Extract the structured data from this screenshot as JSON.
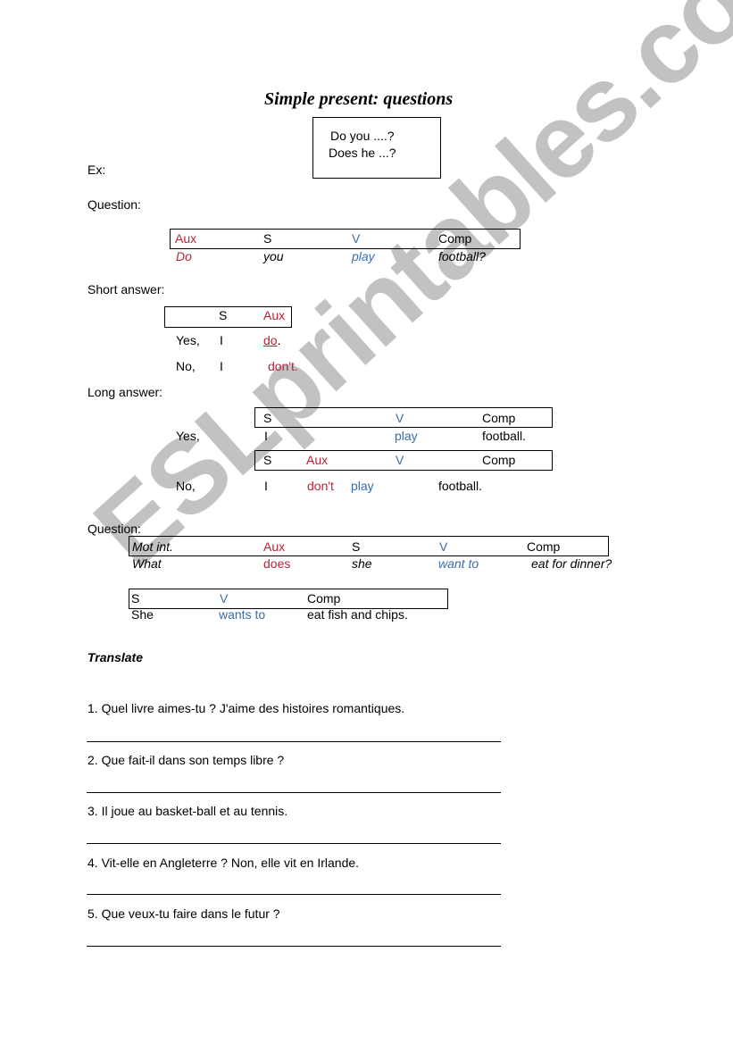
{
  "title": "Simple present: questions",
  "example_box": {
    "line1": "Do you ....?",
    "line2": "Does he ...?"
  },
  "ex_label": "Ex:",
  "question1": {
    "label": "Question:",
    "headers": [
      "Aux",
      "S",
      "V",
      "Comp"
    ],
    "words": [
      "Do",
      "you",
      "play",
      "football?"
    ]
  },
  "short_answer": {
    "label": "Short answer:",
    "headers": [
      "S",
      "Aux"
    ],
    "rows": [
      {
        "lead": "Yes,",
        "s": "I",
        "aux": "do",
        "end": "."
      },
      {
        "lead": "No,",
        "s": "I",
        "aux": "don't.",
        "end": ""
      }
    ]
  },
  "long_answer": {
    "label": "Long answer:",
    "yes": {
      "lead": "Yes,",
      "headers": [
        "S",
        "V",
        "Comp"
      ],
      "words": [
        "I",
        "play",
        "football."
      ]
    },
    "no": {
      "lead": "No,",
      "headers": [
        "S",
        "Aux",
        "V",
        "Comp"
      ],
      "words": [
        "I",
        "don't",
        "play",
        "football."
      ]
    }
  },
  "question2": {
    "label": "Question:",
    "headers": [
      "Mot int.",
      "Aux",
      "S",
      "V",
      "Comp"
    ],
    "words": [
      "What",
      "does",
      "she",
      "want to",
      "eat for dinner?"
    ]
  },
  "answer2": {
    "headers": [
      "S",
      "V",
      "Comp"
    ],
    "words": [
      "She",
      "wants to",
      "eat fish and chips."
    ]
  },
  "translate": {
    "heading": "Translate",
    "items": [
      "1. Quel livre aimes-tu ? J'aime des histoires romantiques.",
      "2. Que fait-il dans son temps libre ?",
      "3. Il joue au basket-ball et au tennis.",
      "4. Vit-elle en Angleterre ? Non, elle vit en Irlande.",
      "5. Que veux-tu faire dans le futur ?"
    ]
  },
  "watermark": "ESLprintables.com",
  "colors": {
    "aux": "#b5253a",
    "verb": "#3a6ea8",
    "text": "#000000"
  }
}
